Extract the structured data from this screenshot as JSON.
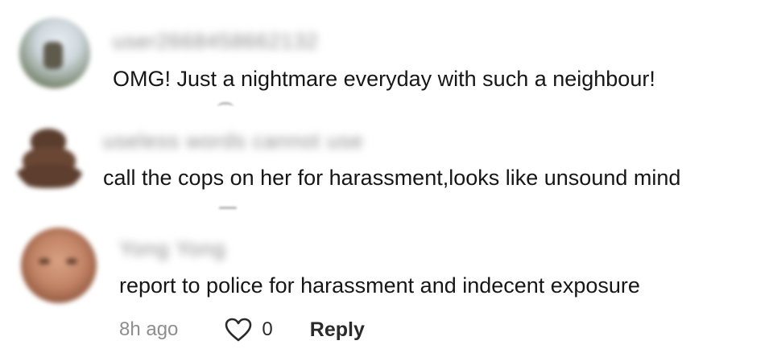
{
  "comments": [
    {
      "username": "user2668458662132",
      "text": "OMG! Just a nightmare everyday with such a neighbour!"
    },
    {
      "username": "useless words cannot use",
      "text": "call the cops on her for harassment,looks like unsound mind"
    },
    {
      "username": "Yong Yong",
      "text": "report to police for harassment and indecent exposure",
      "time": "8h ago",
      "like_count": "0",
      "reply_label": "Reply"
    }
  ],
  "icons": {
    "like": "heart-outline-icon"
  },
  "colors": {
    "text": "#161616",
    "secondary": "#8e8e8e",
    "username": "#8a8a8a"
  }
}
